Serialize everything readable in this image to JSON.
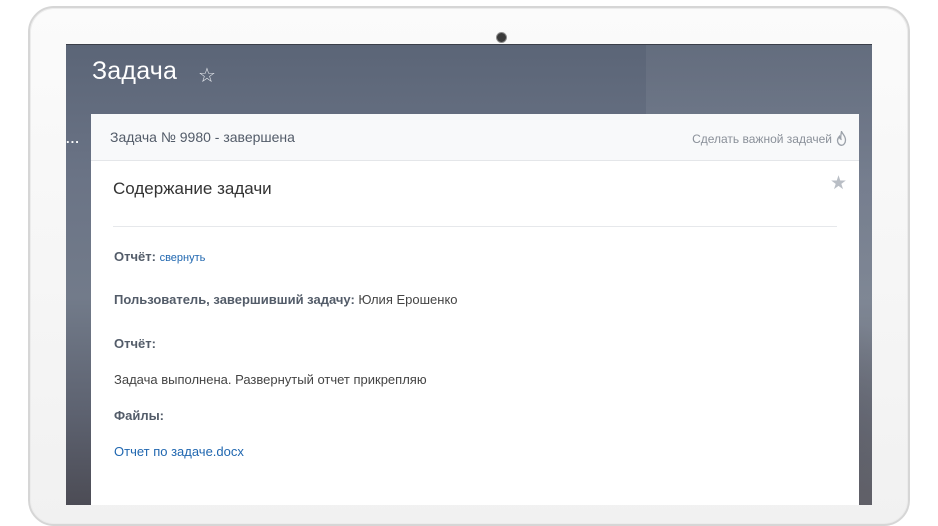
{
  "page": {
    "title": "Задача",
    "star_icon": "star-outline-icon"
  },
  "sidebar": {
    "ellipsis": "..."
  },
  "task": {
    "header": "Задача № 9980 - завершена",
    "make_important_label": "Сделать важной задачей",
    "make_important_icon": "flame-icon",
    "content_title": "Содержание задачи",
    "favorite_icon": "star-icon",
    "report_label": "Отчёт:",
    "collapse_label": "свернуть",
    "completed_by_label": "Пользователь, завершивший задачу:",
    "completed_by_value": "Юлия Ерошенко",
    "report_label_2": "Отчёт:",
    "report_text": "Задача выполнена. Развернутый отчет прикрепляю",
    "files_label": "Файлы:",
    "files": [
      "Отчет по задаче.docx"
    ]
  },
  "colors": {
    "link": "#2067b0",
    "label": "#535c69",
    "screen_background": "#6b7486"
  }
}
